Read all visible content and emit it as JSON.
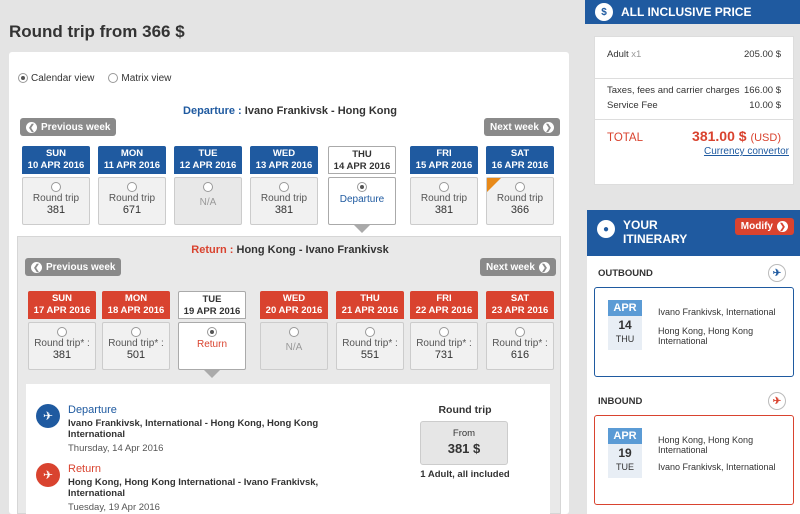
{
  "page": {
    "title": "Round trip from 366 $"
  },
  "view": {
    "calendar": "Calendar view",
    "matrix": "Matrix view"
  },
  "departure": {
    "label": "Departure :",
    "route": "Ivano Frankivsk - Hong Kong",
    "prev": "Previous week",
    "next": "Next week",
    "days": [
      {
        "dow": "SUN",
        "date": "10 APR 2016",
        "kind": "price",
        "label": "Round trip",
        "price": "381"
      },
      {
        "dow": "MON",
        "date": "11 APR 2016",
        "kind": "price",
        "label": "Round trip",
        "price": "671"
      },
      {
        "dow": "TUE",
        "date": "12 APR 2016",
        "kind": "na",
        "label": "N/A",
        "price": ""
      },
      {
        "dow": "WED",
        "date": "13 APR 2016",
        "kind": "price",
        "label": "Round trip",
        "price": "381"
      },
      {
        "dow": "THU",
        "date": "14 APR 2016",
        "kind": "selected",
        "label": "Departure",
        "price": ""
      },
      {
        "dow": "FRI",
        "date": "15 APR 2016",
        "kind": "price",
        "label": "Round trip",
        "price": "381"
      },
      {
        "dow": "SAT",
        "date": "16 APR 2016",
        "kind": "price",
        "label": "Round trip",
        "price": "366"
      }
    ]
  },
  "return": {
    "label": "Return :",
    "route": "Hong Kong - Ivano Frankivsk",
    "prev": "Previous week",
    "next": "Next week",
    "days": [
      {
        "dow": "SUN",
        "date": "17 APR 2016",
        "kind": "price",
        "label": "Round trip* :",
        "price": "381"
      },
      {
        "dow": "MON",
        "date": "18 APR 2016",
        "kind": "price",
        "label": "Round trip* :",
        "price": "501"
      },
      {
        "dow": "TUE",
        "date": "19 APR 2016",
        "kind": "selected",
        "label": "Return",
        "price": ""
      },
      {
        "dow": "WED",
        "date": "20 APR 2016",
        "kind": "na",
        "label": "N/A",
        "price": ""
      },
      {
        "dow": "THU",
        "date": "21 APR 2016",
        "kind": "price",
        "label": "Round trip* :",
        "price": "551"
      },
      {
        "dow": "FRI",
        "date": "22 APR 2016",
        "kind": "price",
        "label": "Round trip* :",
        "price": "731"
      },
      {
        "dow": "SAT",
        "date": "23 APR 2016",
        "kind": "price",
        "label": "Round trip* :",
        "price": "616"
      }
    ]
  },
  "summary": {
    "dep_title": "Departure",
    "dep_route": "Ivano Frankivsk, International - Hong Kong, Hong Kong International",
    "dep_date": "Thursday, 14 Apr 2016",
    "ret_title": "Return",
    "ret_route": "Hong Kong, Hong Kong International - Ivano Frankivsk, International",
    "ret_date": "Tuesday, 19 Apr 2016",
    "rt_label": "Round trip",
    "from": "From",
    "amount": "381 $",
    "note": "1 Adult, all included"
  },
  "price_panel": {
    "title": "ALL INCLUSIVE PRICE",
    "adult_label": "Adult",
    "adult_qty": "x1",
    "adult_value": "205.00 $",
    "taxes_label": "Taxes, fees and carrier charges",
    "taxes_value": "166.00 $",
    "service_label": "Service Fee",
    "service_value": "10.00 $",
    "total_label": "TOTAL",
    "total_value": "381.00 $",
    "total_currency": "(USD)",
    "converter": "Currency convertor"
  },
  "itinerary": {
    "title_line1": "YOUR",
    "title_line2": "ITINERARY",
    "modify": "Modify",
    "outbound": {
      "title": "OUTBOUND",
      "month": "APR",
      "day": "14",
      "dow": "THU",
      "from": "Ivano Frankivsk, International",
      "to": "Hong Kong, Hong Kong International"
    },
    "inbound": {
      "title": "INBOUND",
      "month": "APR",
      "day": "19",
      "dow": "TUE",
      "from": "Hong Kong, Hong Kong International",
      "to": "Ivano Frankivsk, International"
    }
  },
  "colors": {
    "blue": "#1f5aa0",
    "red": "#d9432f",
    "orange": "#e88a1a"
  }
}
